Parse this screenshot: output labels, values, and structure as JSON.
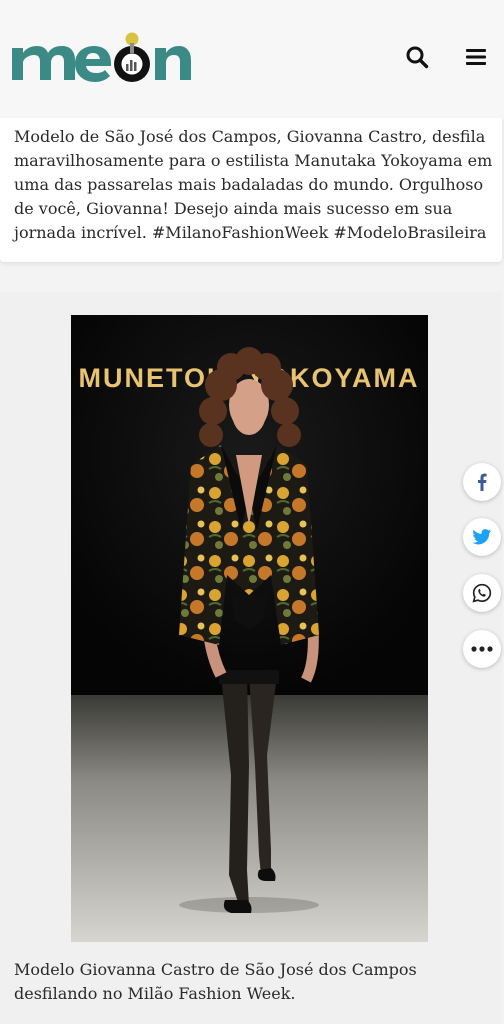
{
  "header": {
    "brand": "meon",
    "brand_color": "#3b8a86",
    "icons": [
      "search-icon",
      "hamburger-menu-icon"
    ]
  },
  "post": {
    "text": "Modelo de São José dos Campos, Giovanna Castro, desfila maravilhosamente para o estilista Manutaka Yokoyama em uma das passarelas mais badaladas do mundo. Orgulhoso de você, Giovanna! Desejo ainda mais sucesso em sua jornada incrível. #MilanoFashionWeek #ModeloBrasileira"
  },
  "photo": {
    "backdrop_text": "MUNETOKI YOKOYAMA"
  },
  "caption": "Modelo Giovanna Castro de São José dos Campos desfilando no Milão Fashion Week.",
  "share": {
    "icons": [
      "facebook-icon",
      "twitter-icon",
      "whatsapp-icon",
      "more-icon"
    ],
    "colors": {
      "facebook": "#3b5998",
      "twitter": "#1da1f2",
      "whatsapp": "#222222"
    }
  }
}
